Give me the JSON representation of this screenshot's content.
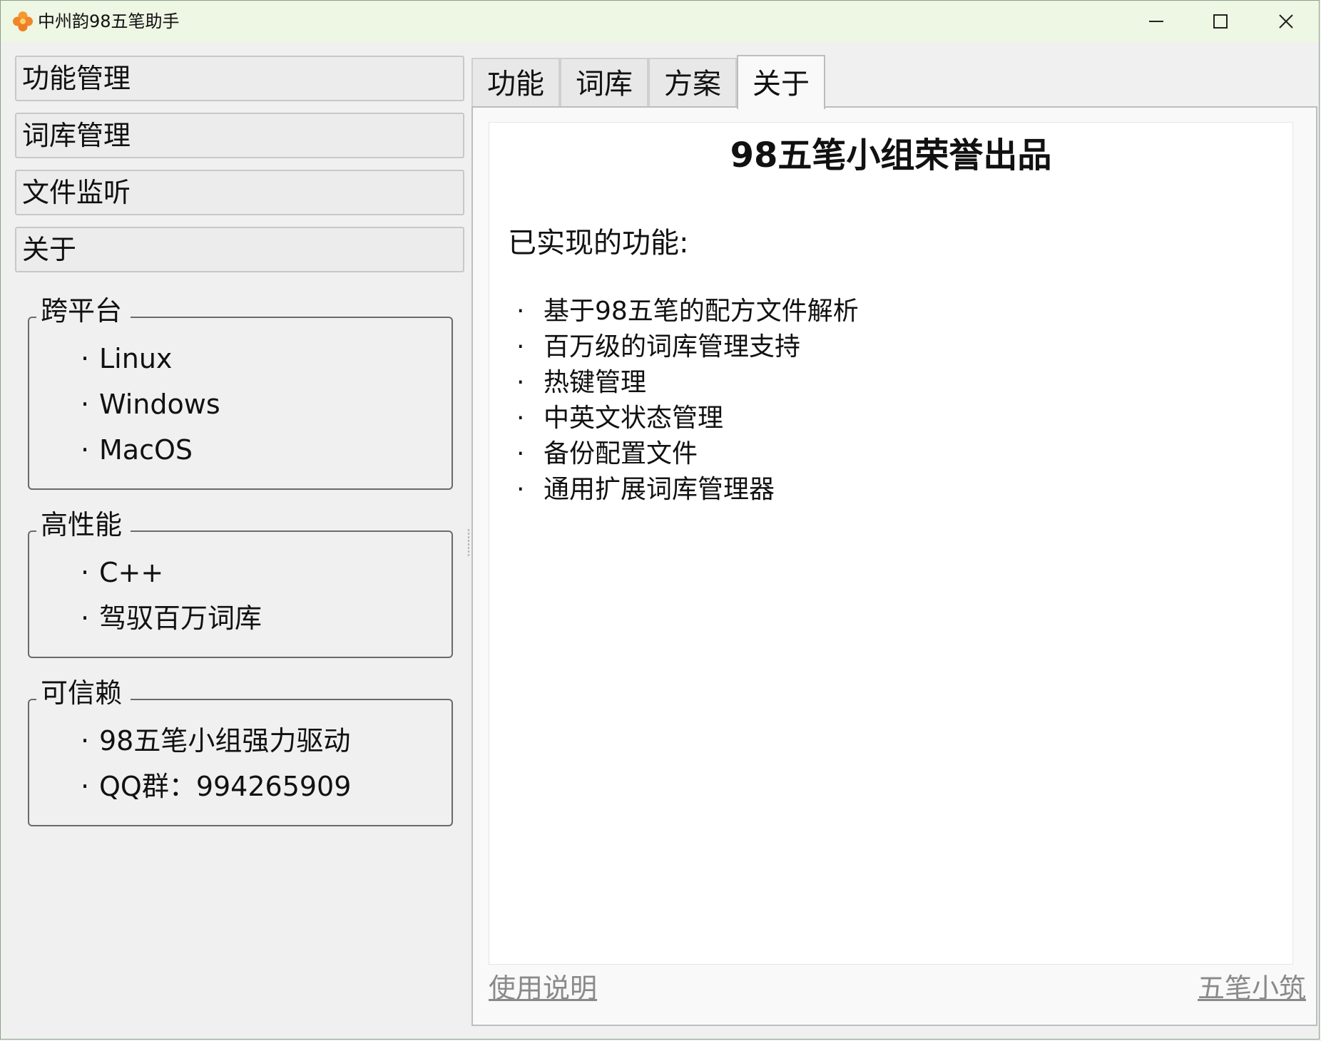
{
  "window": {
    "title": "中州韵98五笔助手",
    "icon": "orange-flower-icon",
    "controls": [
      "minimize-icon",
      "maximize-icon",
      "close-icon"
    ]
  },
  "sidebar": {
    "nav_buttons": [
      {
        "label": "功能管理"
      },
      {
        "label": "词库管理"
      },
      {
        "label": "文件监听"
      },
      {
        "label": "关于"
      }
    ],
    "groups": [
      {
        "title": "跨平台",
        "items": [
          "Linux",
          "Windows",
          "MacOS"
        ]
      },
      {
        "title": "高性能",
        "items": [
          "C++",
          "驾驭百万词库"
        ]
      },
      {
        "title": "可信赖",
        "items": [
          "98五笔小组强力驱动",
          "QQ群：994265909"
        ]
      }
    ],
    "bullet": "·"
  },
  "tabs": [
    {
      "label": "功能",
      "active": false
    },
    {
      "label": "词库",
      "active": false
    },
    {
      "label": "方案",
      "active": false
    },
    {
      "label": "关于",
      "active": true
    }
  ],
  "about": {
    "title": "98五笔小组荣誉出品",
    "features_heading": "已实现的功能:",
    "features": [
      "基于98五笔的配方文件解析",
      "百万级的词库管理支持",
      "热键管理",
      "中英文状态管理",
      "备份配置文件",
      "通用扩展词库管理器"
    ]
  },
  "footer": {
    "help_link": "使用说明",
    "site_link": "五笔小筑"
  },
  "colors": {
    "titlebar": "#eef6e4",
    "background": "#f0f0f0",
    "link": "#8a8a8a",
    "icon": "#f08a24"
  }
}
